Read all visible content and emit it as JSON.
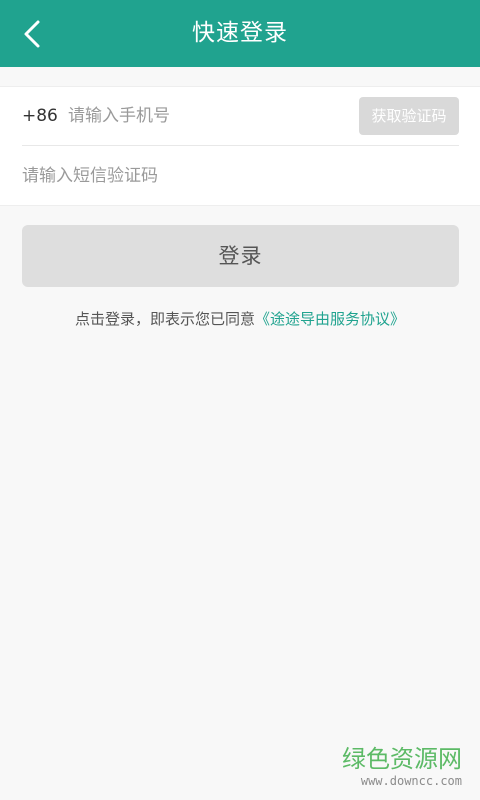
{
  "header": {
    "title": "快速登录",
    "back_icon": "chevron-left-icon"
  },
  "form": {
    "country_code": "+86",
    "phone_placeholder": "请输入手机号",
    "phone_value": "",
    "get_code_label": "获取验证码",
    "sms_placeholder": "请输入短信验证码",
    "sms_value": ""
  },
  "login": {
    "button_label": "登录"
  },
  "agreement": {
    "text": "点击登录，即表示您已同意",
    "link_text": "《途途导由服务协议》"
  },
  "watermark": {
    "main": "绿色资源网",
    "sub": "www.downcc.com"
  },
  "colors": {
    "accent": "#20a38f",
    "button_disabled": "#dedede"
  }
}
